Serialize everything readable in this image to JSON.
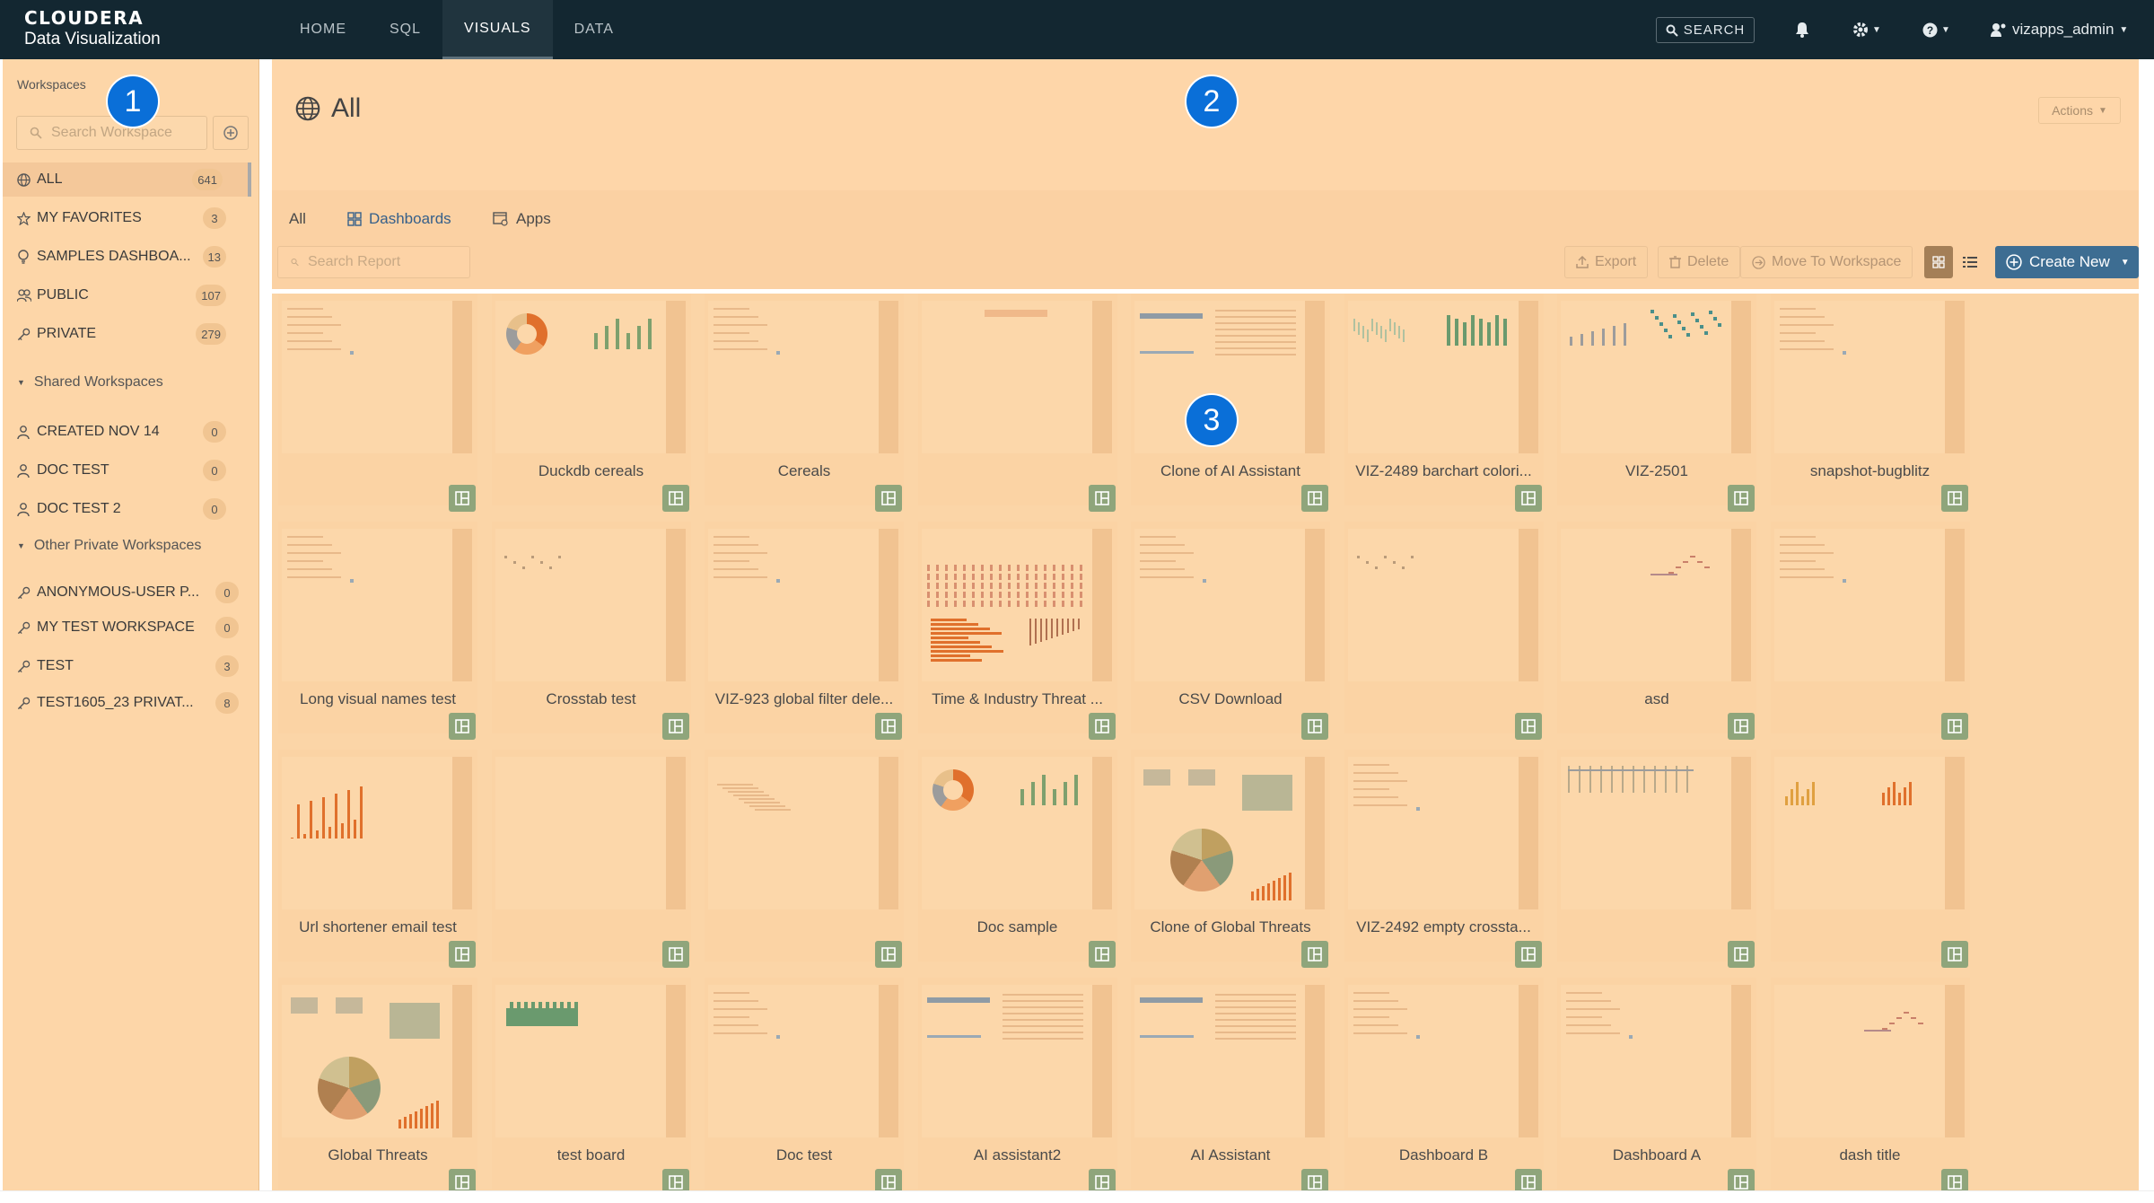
{
  "app": {
    "brand_name": "CLOUDERA",
    "brand_sub": "Data Visualization"
  },
  "nav": {
    "items": [
      {
        "label": "HOME"
      },
      {
        "label": "SQL"
      },
      {
        "label": "VISUALS"
      },
      {
        "label": "DATA"
      }
    ],
    "active": "VISUALS",
    "search_label": "SEARCH",
    "user": "vizapps_admin"
  },
  "sidebar": {
    "title": "Workspaces",
    "search_placeholder": "Search Workspace",
    "items": [
      {
        "label": "ALL",
        "count": "641",
        "icon": "globe-icon"
      },
      {
        "label": "MY FAVORITES",
        "count": "3",
        "icon": "star-icon"
      },
      {
        "label": "SAMPLES DASHBOA...",
        "count": "13",
        "icon": "lightbulb-icon"
      },
      {
        "label": "PUBLIC",
        "count": "107",
        "icon": "users-icon"
      },
      {
        "label": "PRIVATE",
        "count": "279",
        "icon": "key-icon"
      }
    ],
    "shared_title": "Shared Workspaces",
    "shared_items": [
      {
        "label": "CREATED NOV 14",
        "count": "0",
        "icon": "user-icon"
      },
      {
        "label": "DOC TEST",
        "count": "0",
        "icon": "user-icon"
      },
      {
        "label": "DOC TEST 2",
        "count": "0",
        "icon": "user-icon"
      }
    ],
    "other_title": "Other Private Workspaces",
    "other_items": [
      {
        "label": "ANONYMOUS-USER P...",
        "count": "0",
        "icon": "key-icon"
      },
      {
        "label": "MY TEST WORKSPACE",
        "count": "0",
        "icon": "key-icon"
      },
      {
        "label": "TEST",
        "count": "3",
        "icon": "key-icon"
      },
      {
        "label": "TEST1605_23 PRIVAT...",
        "count": "8",
        "icon": "key-icon"
      }
    ]
  },
  "main": {
    "title": "All",
    "actions_label": "Actions",
    "tabs": [
      {
        "label": "All"
      },
      {
        "label": "Dashboards"
      },
      {
        "label": "Apps"
      }
    ],
    "search_placeholder": "Search Report",
    "export_label": "Export",
    "delete_label": "Delete",
    "move_label": "Move To Workspace",
    "create_label": "Create New"
  },
  "cards": [
    {
      "name": ""
    },
    {
      "name": "Duckdb cereals"
    },
    {
      "name": "Cereals"
    },
    {
      "name": ""
    },
    {
      "name": "Clone of AI Assistant"
    },
    {
      "name": "VIZ-2489 barchart colori..."
    },
    {
      "name": "VIZ-2501"
    },
    {
      "name": "snapshot-bugblitz"
    },
    {
      "name": "Long visual names test"
    },
    {
      "name": "Crosstab test"
    },
    {
      "name": "VIZ-923 global filter dele..."
    },
    {
      "name": "Time & Industry Threat ..."
    },
    {
      "name": "CSV Download"
    },
    {
      "name": ""
    },
    {
      "name": "asd"
    },
    {
      "name": ""
    },
    {
      "name": "Url shortener email test"
    },
    {
      "name": ""
    },
    {
      "name": ""
    },
    {
      "name": "Doc sample"
    },
    {
      "name": "Clone of Global Threats"
    },
    {
      "name": "VIZ-2492 empty crossta..."
    },
    {
      "name": ""
    },
    {
      "name": ""
    },
    {
      "name": "Global Threats"
    },
    {
      "name": "test board"
    },
    {
      "name": "Doc test"
    },
    {
      "name": "AI assistant2"
    },
    {
      "name": "AI Assistant"
    },
    {
      "name": "Dashboard B"
    },
    {
      "name": "Dashboard A"
    },
    {
      "name": "dash title"
    }
  ],
  "badges": [
    "1",
    "2",
    "3"
  ],
  "colors": {
    "topbar": "#132731",
    "overlay": "#fdd6a8",
    "badge": "#0a6fd8",
    "create_button": "#3d6d92",
    "dashboard_icon": "#8fa57b"
  }
}
